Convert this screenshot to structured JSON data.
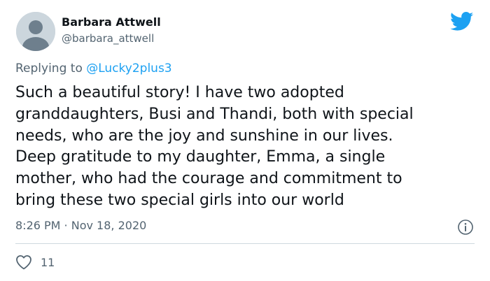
{
  "author": {
    "display_name": "Barbara Attwell",
    "handle": "@barbara_attwell"
  },
  "reply": {
    "prefix": "Replying to ",
    "mention": "@Lucky2plus3"
  },
  "tweet": {
    "text": "Such a beautiful story! I have two adopted\ngranddaughters, Busi and Thandi, both with special\nneeds, who are the joy and sunshine in our lives.\nDeep gratitude to my daughter, Emma, a single\nmother, who had the courage and commitment to\nbring these two special girls into our world",
    "time": "8:26 PM",
    "separator": " · ",
    "date": "Nov 18, 2020"
  },
  "stats": {
    "likes": "11"
  },
  "icons": {
    "brand": "twitter-bird-icon",
    "info": "info-icon",
    "like": "heart-icon"
  },
  "colors": {
    "brand_blue": "#1da1f2",
    "secondary_text": "#536471",
    "avatar_bg": "#ccd6dd"
  }
}
